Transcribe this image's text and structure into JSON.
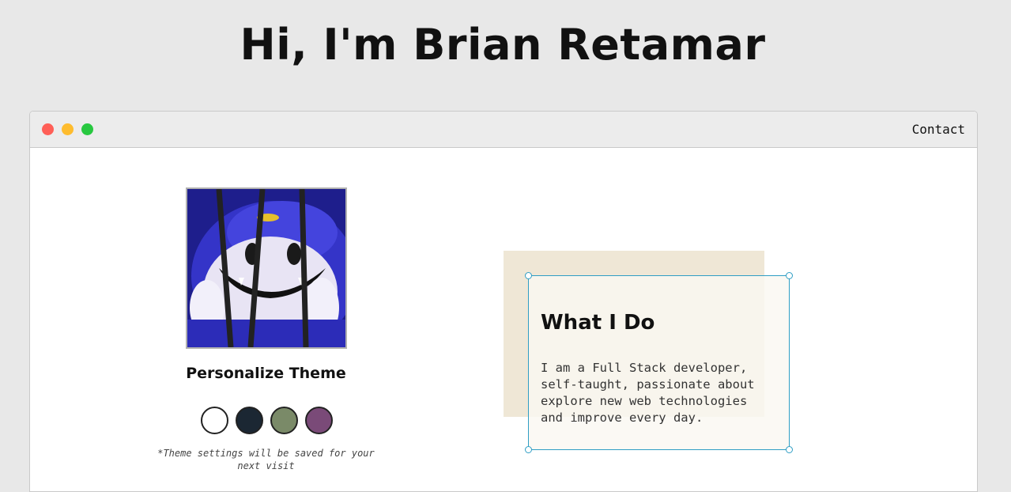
{
  "hero": {
    "title": "Hi, I'm Brian Retamar"
  },
  "window": {
    "controls": [
      "close",
      "minimize",
      "maximize"
    ],
    "nav": {
      "contact_label": "Contact"
    }
  },
  "profile": {
    "avatar_icon": "cartoon-character-image"
  },
  "theme": {
    "title": "Personalize Theme",
    "swatches": [
      {
        "name": "light",
        "color": "#ffffff"
      },
      {
        "name": "dark",
        "color": "#1b2733"
      },
      {
        "name": "sage",
        "color": "#7a8a68"
      },
      {
        "name": "plum",
        "color": "#7a4a78"
      }
    ],
    "note": "*Theme settings will be saved for your next visit"
  },
  "about": {
    "heading": "What I Do",
    "text": "I am a Full Stack developer,\nself-taught, passionate about\nexplore new web technologies\nand improve every day."
  }
}
